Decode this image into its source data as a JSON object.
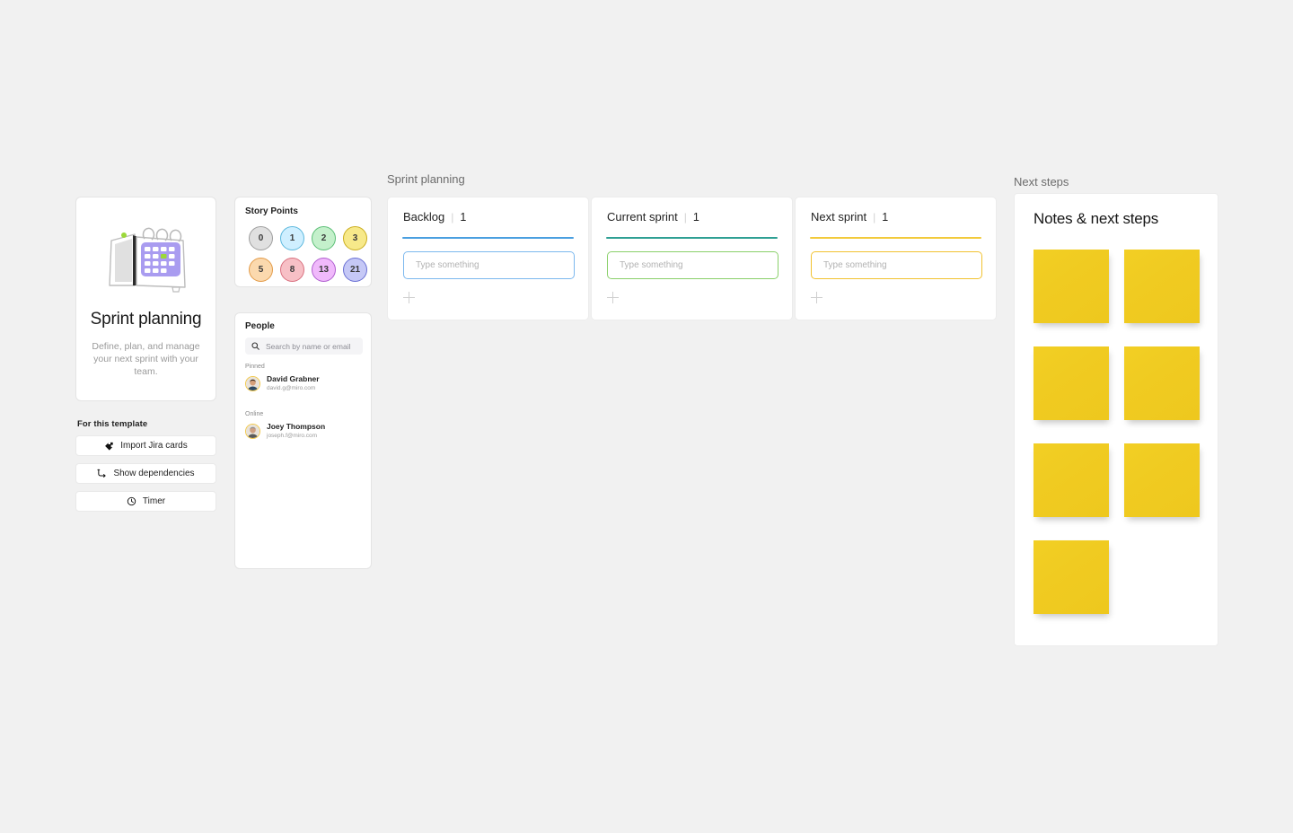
{
  "background_color": "#f1f1f1",
  "template_card": {
    "illustration": "desk-calendar-illustration",
    "title": "Sprint planning",
    "description": "Define, plan, and manage your next sprint with your team."
  },
  "for_this_template": {
    "label": "For this template",
    "buttons": [
      {
        "icon": "jira-import-icon",
        "label": "Import Jira cards"
      },
      {
        "icon": "dependencies-icon",
        "label": "Show dependencies"
      },
      {
        "icon": "timer-clock-icon",
        "label": "Timer"
      }
    ]
  },
  "story_points": {
    "title": "Story Points",
    "chips": [
      {
        "value": "0",
        "fill": "#e0e0e0",
        "border": "#9e9e9e"
      },
      {
        "value": "1",
        "fill": "#cfefff",
        "border": "#5cb8dd"
      },
      {
        "value": "2",
        "fill": "#c4f0cb",
        "border": "#5cbf77"
      },
      {
        "value": "3",
        "fill": "#f7e98a",
        "border": "#cbae1f"
      },
      {
        "value": "5",
        "fill": "#fbd9ae",
        "border": "#e39b48"
      },
      {
        "value": "8",
        "fill": "#f7c0c6",
        "border": "#d9707f"
      },
      {
        "value": "13",
        "fill": "#f0b9fb",
        "border": "#c martin"
      },
      {
        "value": "21",
        "fill": "#c5c8f6",
        "border": "#6a70d4"
      }
    ]
  },
  "people": {
    "title": "People",
    "search": {
      "icon": "search-icon",
      "placeholder": "Search by name or email",
      "value": ""
    },
    "groups": [
      {
        "label": "Pinned",
        "members": [
          {
            "name": "David Grabner",
            "email": "david.g@miro.com",
            "avatar": "avatar-david"
          }
        ]
      },
      {
        "label": "Online",
        "members": [
          {
            "name": "Joey Thompson",
            "email": "joseph.f@miro.com",
            "avatar": "avatar-joey"
          }
        ]
      }
    ]
  },
  "sprint_planning": {
    "section_label": "Sprint planning",
    "columns": [
      {
        "name": "Backlog",
        "separator": "|",
        "count": "1",
        "rule_color": "#4a9fe0",
        "input_border": "#7cb8ee",
        "placeholder": "Type something",
        "value": "",
        "add_icon": "plus-icon"
      },
      {
        "name": "Current sprint",
        "separator": "|",
        "count": "1",
        "rule_color": "#2fa094",
        "input_border": "#8ad06a",
        "placeholder": "Type something",
        "value": "",
        "add_icon": "plus-icon"
      },
      {
        "name": "Next sprint",
        "separator": "|",
        "count": "1",
        "rule_color": "#f2ca3c",
        "input_border": "#f2c230",
        "placeholder": "Type something",
        "value": "",
        "add_icon": "plus-icon"
      }
    ]
  },
  "next_steps": {
    "section_label": "Next steps",
    "board_title": "Notes & next steps",
    "sticky_color": "#f0cb21",
    "sticky_notes": [
      {
        "text": ""
      },
      {
        "text": ""
      },
      {
        "text": ""
      },
      {
        "text": ""
      },
      {
        "text": ""
      },
      {
        "text": ""
      },
      {
        "text": ""
      }
    ]
  }
}
